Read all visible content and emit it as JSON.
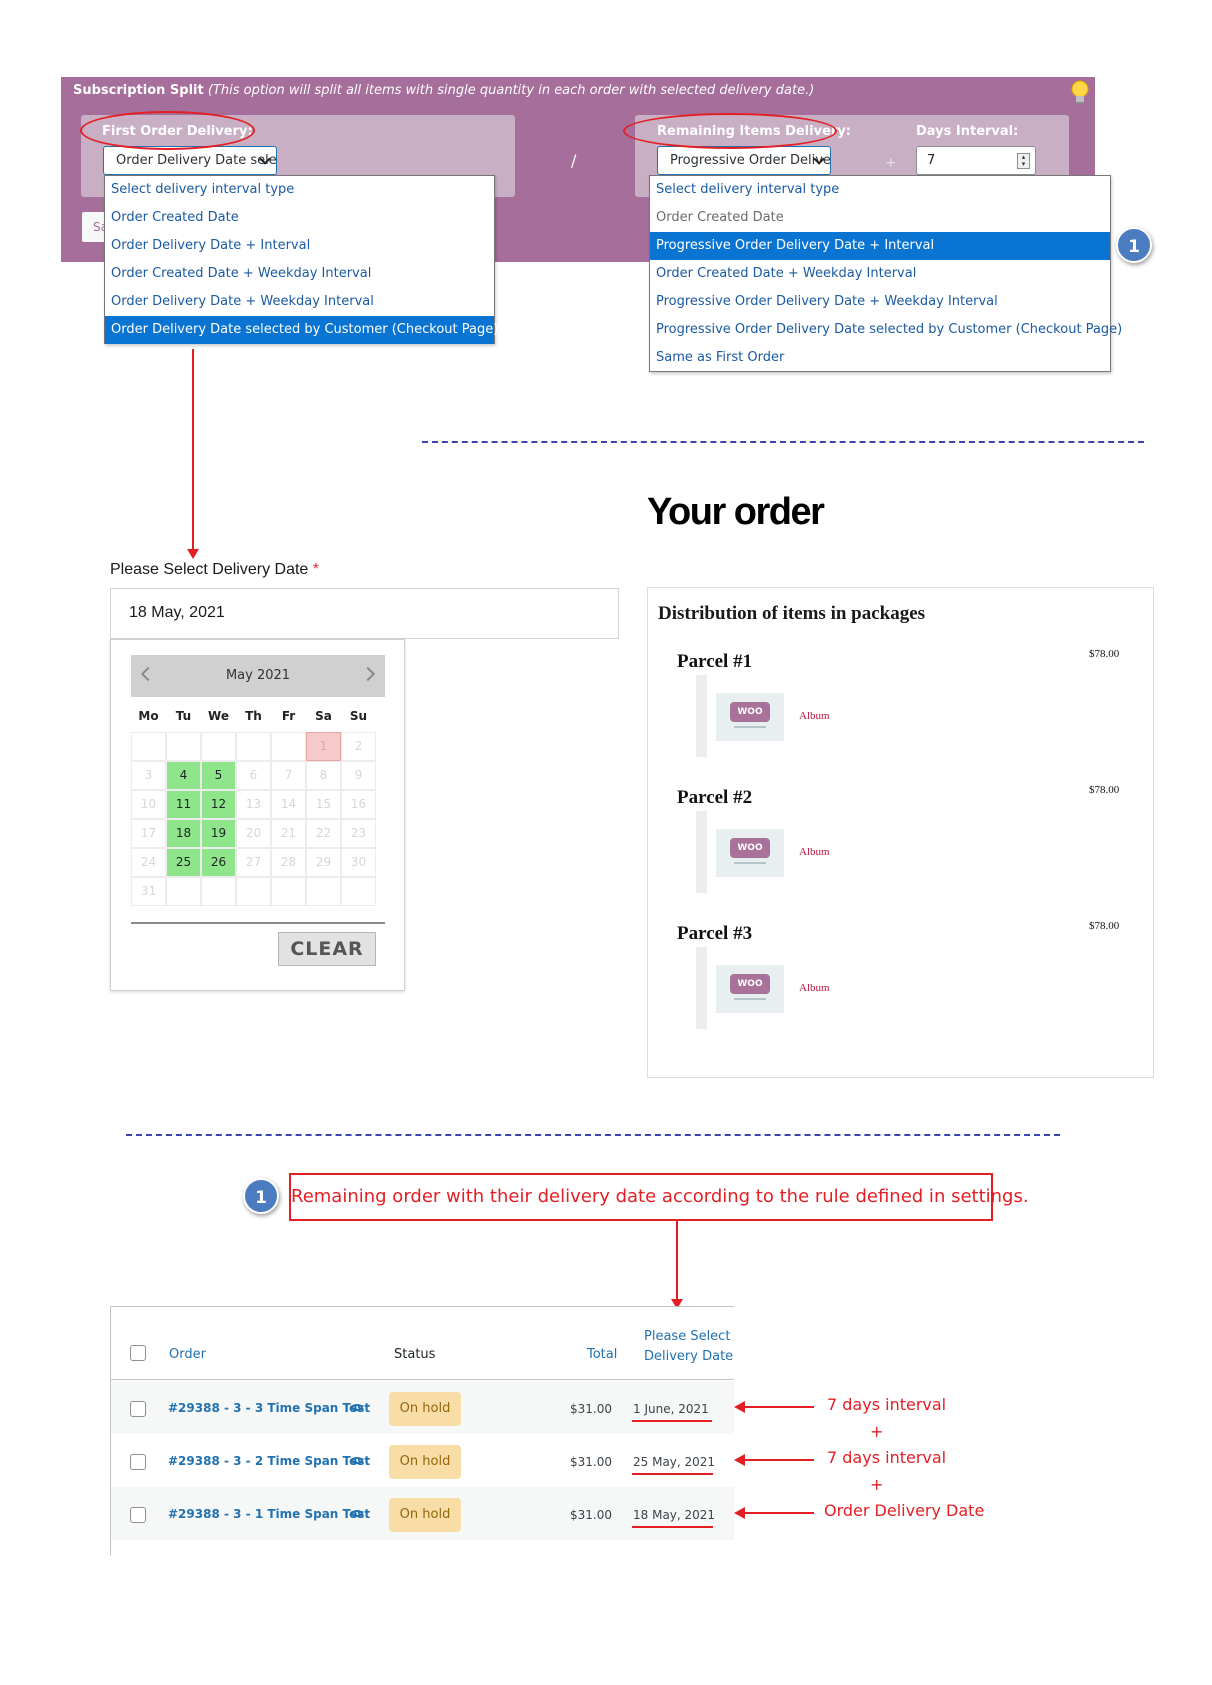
{
  "settings": {
    "title_bold": "Subscription Split",
    "title_italic": "(This option will split all items with single quantity in each order with selected delivery date.)",
    "first_label": "First Order Delivery:",
    "first_select_value": "Order Delivery Date sele",
    "remaining_label": "Remaining Items Delivery:",
    "remaining_select_value": "Progressive Order Delive",
    "days_interval_label": "Days Interval:",
    "days_interval_value": "7",
    "separator": "/",
    "plus": "+",
    "save_partial": "Sa",
    "first_options": [
      "Select delivery interval type",
      "Order Created Date",
      "Order Delivery Date + Interval",
      "Order Created Date + Weekday Interval",
      "Order Delivery Date + Weekday Interval",
      "Order Delivery Date selected by Customer (Checkout Page)"
    ],
    "first_selected_index": 5,
    "remaining_options": [
      "Select delivery interval type",
      "Order Created Date",
      "Progressive Order Delivery Date + Interval",
      "Order Created Date + Weekday Interval",
      "Progressive Order Delivery Date + Weekday Interval",
      "Progressive Order Delivery Date selected by Customer (Checkout Page)",
      "Same as First Order"
    ],
    "remaining_selected_index": 2,
    "badge": "1",
    "colors": {
      "panel": "#a66e9a",
      "selected_option": "#0a74d2",
      "annotation": "#e31e24"
    }
  },
  "datepicker": {
    "label": "Please Select Delivery Date",
    "required_mark": "*",
    "value": "18 May, 2021",
    "month_title": "May 2021",
    "weekdays": [
      "Mo",
      "Tu",
      "We",
      "Th",
      "Fr",
      "Sa",
      "Su"
    ],
    "weeks": [
      [
        "",
        "",
        "",
        "",
        "",
        "1",
        "2"
      ],
      [
        "3",
        "4",
        "5",
        "6",
        "7",
        "8",
        "9"
      ],
      [
        "10",
        "11",
        "12",
        "13",
        "14",
        "15",
        "16"
      ],
      [
        "17",
        "18",
        "19",
        "20",
        "21",
        "22",
        "23"
      ],
      [
        "24",
        "25",
        "26",
        "27",
        "28",
        "29",
        "30"
      ],
      [
        "31",
        "",
        "",
        "",
        "",
        "",
        ""
      ]
    ],
    "available_days": [
      "4",
      "5",
      "11",
      "12",
      "18",
      "19",
      "25",
      "26"
    ],
    "today": "1",
    "clear_label": "CLEAR",
    "colors": {
      "available": "#8ee58a",
      "today": "#f7caca"
    }
  },
  "order_summary": {
    "heading": "Your order",
    "packages_title": "Distribution of items in packages",
    "parcels": [
      {
        "title": "Parcel #1",
        "price": "$78.00",
        "item": "Album",
        "logo": "WOO"
      },
      {
        "title": "Parcel #2",
        "price": "$78.00",
        "item": "Album",
        "logo": "WOO"
      },
      {
        "title": "Parcel #3",
        "price": "$78.00",
        "item": "Album",
        "logo": "WOO"
      }
    ]
  },
  "note": {
    "badge": "1",
    "text": "Remaining order with their delivery date according to the rule defined in settings."
  },
  "orders_table": {
    "headers": {
      "order": "Order",
      "status": "Status",
      "total": "Total",
      "delivery_line1": "Please Select",
      "delivery_line2": "Delivery Date"
    },
    "rows": [
      {
        "order": "#29388 - 3 - 3 Time Span Test",
        "status": "On hold",
        "total": "$31.00",
        "delivery": "1 June, 2021",
        "annotation": "7 days interval"
      },
      {
        "order": "#29388 - 3 - 2 Time Span Test",
        "status": "On hold",
        "total": "$31.00",
        "delivery": "25 May, 2021",
        "annotation": "7 days interval"
      },
      {
        "order": "#29388 - 3 - 1 Time Span Test",
        "status": "On hold",
        "total": "$31.00",
        "delivery": "18 May, 2021",
        "annotation": "Order Delivery Date"
      }
    ],
    "plus": "+"
  }
}
